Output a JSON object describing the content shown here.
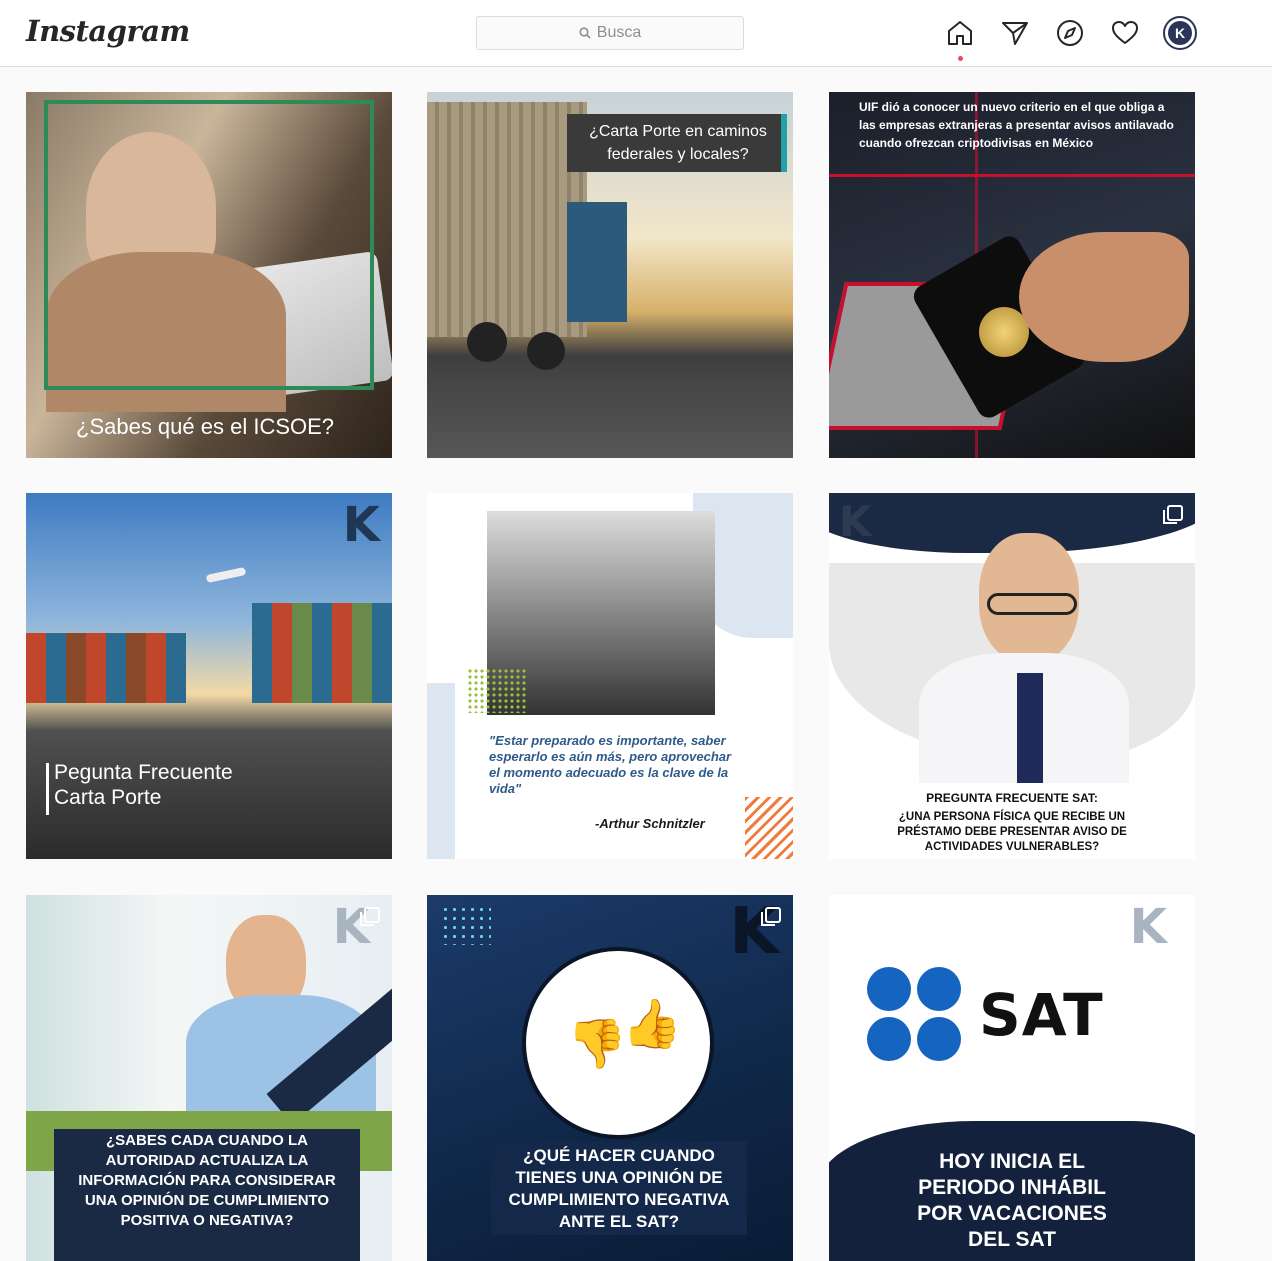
{
  "app": {
    "logo": "Instagram"
  },
  "search": {
    "placeholder": "Busca"
  },
  "nav": {
    "icons": [
      "home-icon",
      "direct-icon",
      "explore-icon",
      "activity-icon",
      "profile-avatar"
    ]
  },
  "posts": [
    {
      "text": "¿Sabes qué es el ICSOE?"
    },
    {
      "text": "¿Carta Porte en caminos federales y locales?"
    },
    {
      "text": "UIF dió a conocer un nuevo criterio en el que obliga a las empresas extranjeras a presentar avisos antilavado cuando ofrezcan criptodivisas en México"
    },
    {
      "line1": "Pegunta Frecuente",
      "line2": "Carta Porte"
    },
    {
      "quote": "\"Estar preparado es importante, saber esperarlo es aún más, pero aprovechar el momento adecuado es la clave de la vida\"",
      "author": "-Arthur Schnitzler"
    },
    {
      "heading": "PREGUNTA FRECUENTE SAT:",
      "text": "¿UNA PERSONA FÍSICA QUE RECIBE UN PRÉSTAMO DEBE PRESENTAR AVISO DE ACTIVIDADES VULNERABLES?"
    },
    {
      "text": "¿SABES CADA CUANDO LA AUTORIDAD ACTUALIZA LA INFORMACIÓN PARA CONSIDERAR UNA OPINIÓN DE CUMPLIMIENTO POSITIVA O NEGATIVA?"
    },
    {
      "text": "¿QUÉ HACER CUANDO TIENES UNA OPINIÓN DE CUMPLIMIENTO NEGATIVA ANTE EL SAT?"
    },
    {
      "brand": "SAT",
      "text": "HOY INICIA EL PERIODO INHÁBIL POR VACACIONES DEL SAT"
    }
  ],
  "colors": {
    "accent_green": "#2e8b57",
    "navy": "#14213d",
    "notification": "#ed4956",
    "sat_blue": "#1565c0"
  }
}
